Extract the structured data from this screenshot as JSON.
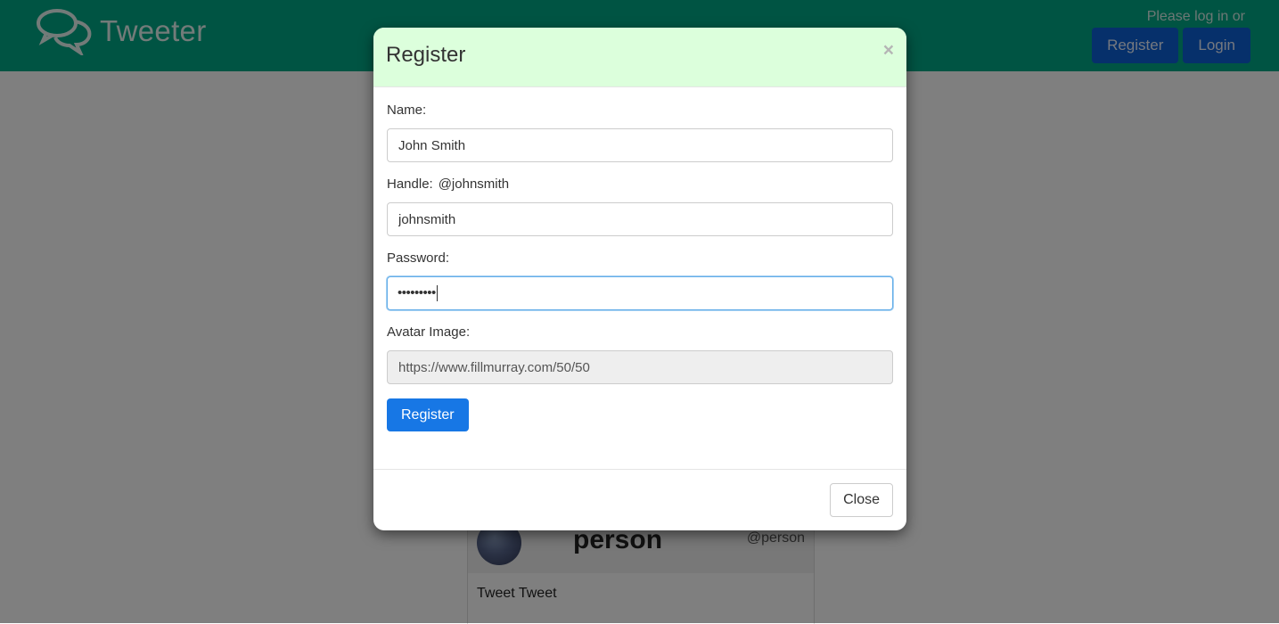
{
  "navbar": {
    "brand": "Tweeter",
    "prompt": "Please log in or register",
    "register_label": "Register",
    "login_label": "Login"
  },
  "tweet": {
    "name": "person",
    "handle": "@person",
    "text": "Tweet Tweet"
  },
  "modal": {
    "title": "Register",
    "close_x": "×",
    "fields": {
      "name": {
        "label": "Name:",
        "value": "John Smith"
      },
      "handle": {
        "label": "Handle:",
        "preview": "@johnsmith",
        "value": "johnsmith"
      },
      "password": {
        "label": "Password:",
        "masked": "•••••••••"
      },
      "avatar": {
        "label": "Avatar Image:",
        "value": "https://www.fillmurray.com/50/50"
      }
    },
    "submit_label": "Register",
    "close_label": "Close"
  },
  "colors": {
    "navbar": "#00a887",
    "nav_button": "#0d60d6",
    "modal_header": "#dcffdc",
    "primary_button": "#1777e5"
  }
}
